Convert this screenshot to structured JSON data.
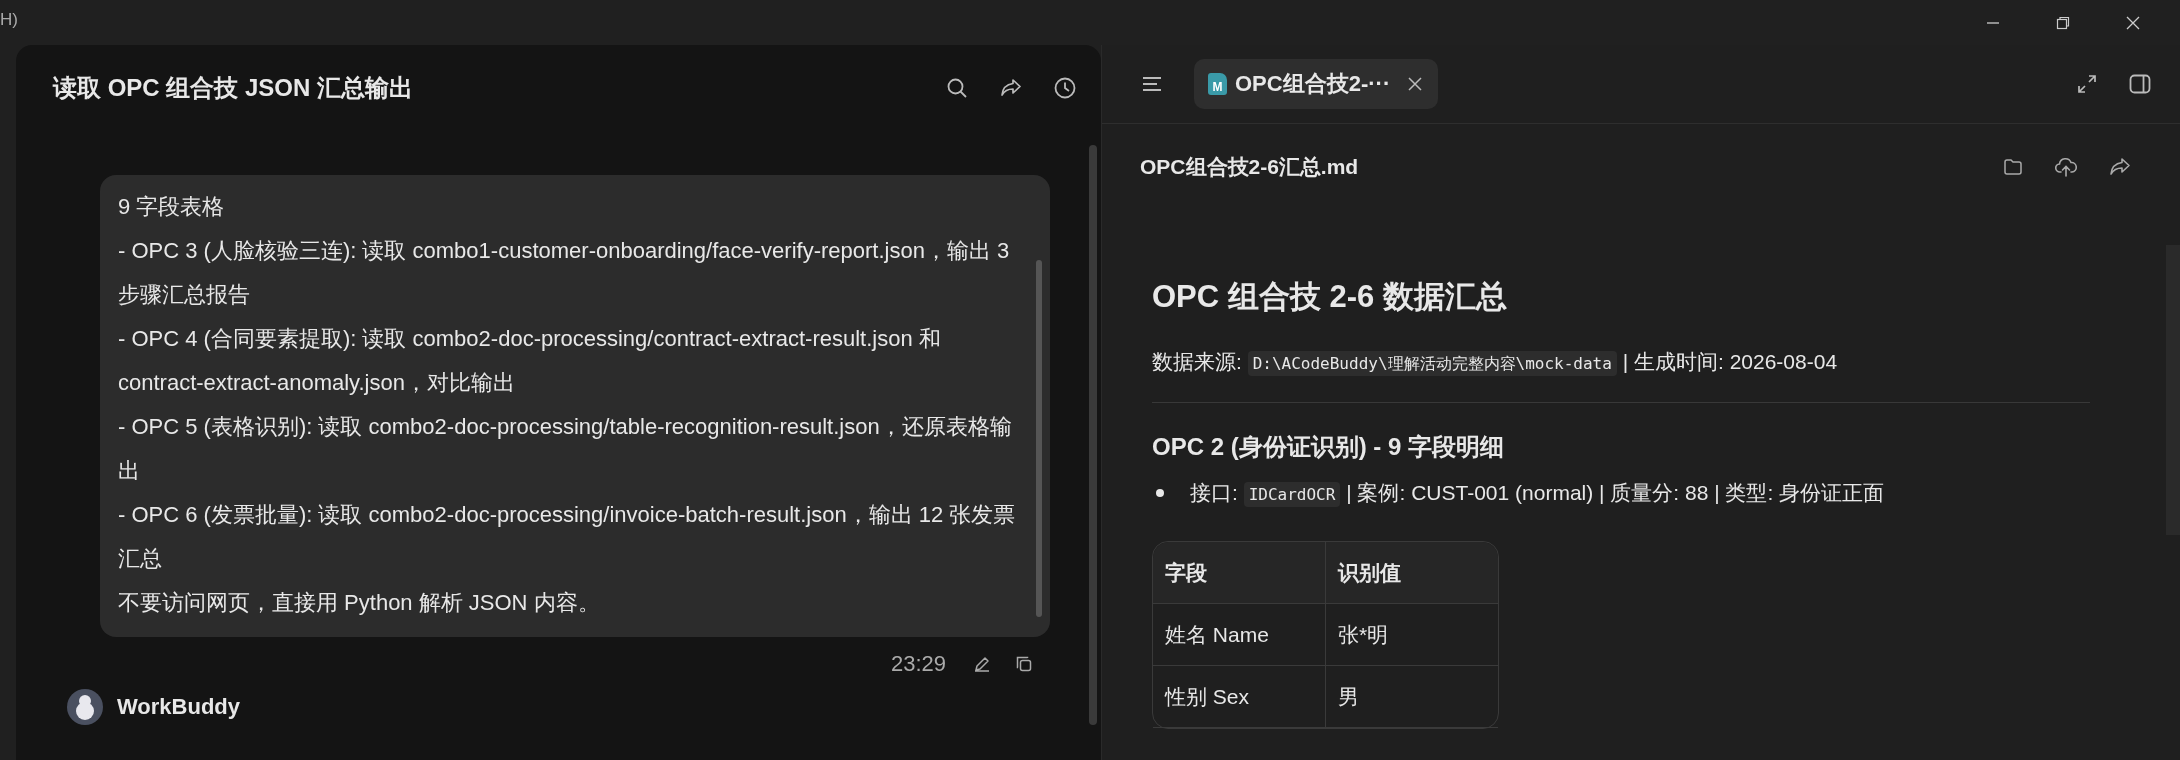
{
  "menu_fragment": "H)",
  "chat": {
    "title": "读取 OPC 组合技 JSON 汇总输出",
    "message": {
      "lines": [
        "9 字段表格",
        "- OPC 3 (人脸核验三连): 读取 combo1-customer-onboarding/face-verify-report.json，输出 3 步骤汇总报告",
        "- OPC 4 (合同要素提取): 读取 combo2-doc-processing/contract-extract-result.json 和 contract-extract-anomaly.json，对比输出",
        "- OPC 5 (表格识别): 读取 combo2-doc-processing/table-recognition-result.json，还原表格输出",
        "- OPC 6 (发票批量): 读取 combo2-doc-processing/invoice-batch-result.json，输出 12 张发票汇总",
        "不要访问网页，直接用 Python 解析 JSON 内容。"
      ],
      "time": "23:29"
    },
    "assistant": {
      "name": "WorkBuddy"
    }
  },
  "preview": {
    "tabs": [
      {
        "label": "OPC组合技2-···",
        "icon_letter": "M",
        "selected": true
      }
    ],
    "file_name": "OPC组合技2-6汇总.md",
    "doc": {
      "h1": "OPC 组合技 2-6 数据汇总",
      "source": {
        "label": "数据来源: ",
        "code": "D:\\ACodeBuddy\\理解活动完整内容\\mock-data",
        "rest": " | 生成时间: 2026-08-04"
      },
      "h3": "OPC 2 (身份证识别) - 9 字段明细",
      "bullets": [
        {
          "label": "接口: ",
          "code": "IDCardOCR",
          "rest": " | 案例: CUST-001 (normal) | 质量分: 88 | 类型: 身份证正面"
        }
      ],
      "table": {
        "columns": [
          "字段",
          "识别值"
        ],
        "rows": [
          [
            "姓名 Name",
            "张*明"
          ],
          [
            "性别 Sex",
            "男"
          ]
        ]
      }
    }
  }
}
